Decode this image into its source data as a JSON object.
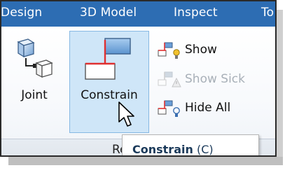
{
  "tabs": [
    {
      "label": "Design"
    },
    {
      "label": "3D Model"
    },
    {
      "label": "Inspect"
    },
    {
      "label": "To"
    }
  ],
  "ribbon": {
    "joint_label": "Joint",
    "constrain_label": "Constrain",
    "small_buttons": [
      {
        "label": "Show",
        "icon": "constraint-show-icon",
        "enabled": true
      },
      {
        "label": "Show Sick",
        "icon": "constraint-show-sick-icon",
        "enabled": false
      },
      {
        "label": "Hide All",
        "icon": "constraint-hide-all-icon",
        "enabled": true
      }
    ],
    "group_label": "Relat"
  },
  "tooltip": {
    "name": "Constrain",
    "shortcut": "(C)"
  },
  "colors": {
    "tab_bar": "#2d6db3",
    "selected_button": "#cfe6f8",
    "disabled_text": "#a8b0b8"
  }
}
